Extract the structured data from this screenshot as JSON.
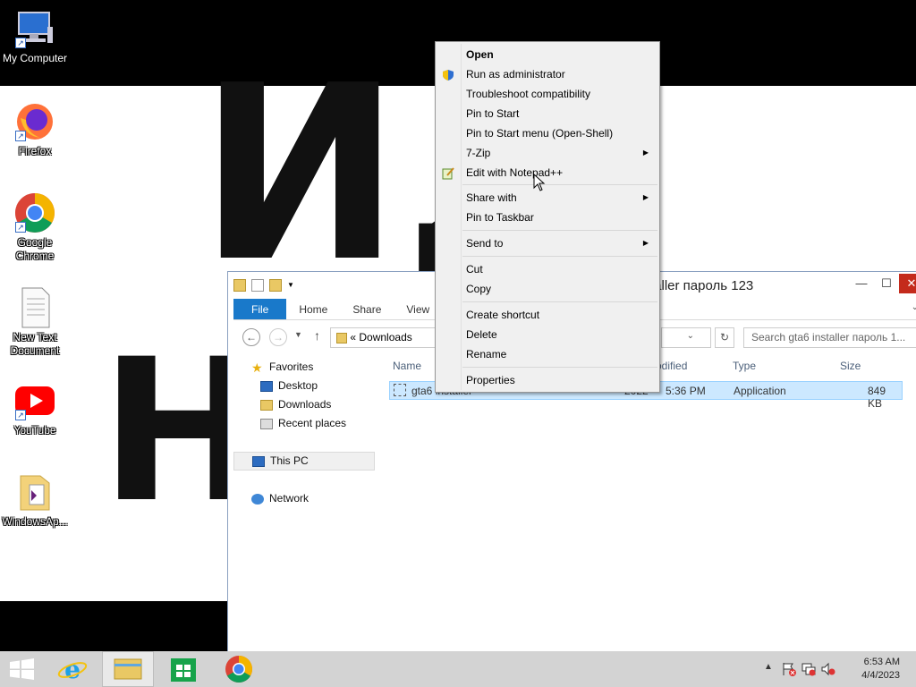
{
  "desktop": {
    "icons": [
      {
        "label": "My Computer"
      },
      {
        "label": "Firefox"
      },
      {
        "label": "Google Chrome"
      },
      {
        "label": "New Text Document"
      },
      {
        "label": "YouTube"
      },
      {
        "label": "WindowsAp..."
      }
    ],
    "wallpaper_text_top": "ИД",
    "wallpaper_text_bottom": "Н"
  },
  "explorer": {
    "title": "tallerпароль 123",
    "title_display": "taller пароль 123",
    "ribbon_tabs": [
      "File",
      "Home",
      "Share",
      "View"
    ],
    "address_prefix": "«",
    "address": "Downloads",
    "search_placeholder": "Search gta6 installer пароль 1...",
    "nav": {
      "favorites": "Favorites",
      "desktop": "Desktop",
      "downloads": "Downloads",
      "recent": "Recent places",
      "thispc": "This PC",
      "network": "Network"
    },
    "columns": {
      "name": "Name",
      "modified": "odified",
      "type": "Type",
      "size": "Size"
    },
    "file": {
      "name": "gta6 installer",
      "date": "5:36 PM",
      "date_prefix": "2022",
      "type": "Application",
      "size": "849 KB"
    }
  },
  "context_menu": {
    "items": [
      {
        "label": "Open"
      },
      {
        "label": "Run as administrator"
      },
      {
        "label": "Troubleshoot compatibility"
      },
      {
        "label": "Pin to Start"
      },
      {
        "label": "Pin to Start menu (Open-Shell)"
      },
      {
        "label": "7-Zip"
      },
      {
        "label": "Edit with Notepad++"
      },
      {
        "label": "Share with"
      },
      {
        "label": "Pin to Taskbar"
      },
      {
        "label": "Send to"
      },
      {
        "label": "Cut"
      },
      {
        "label": "Copy"
      },
      {
        "label": "Create shortcut"
      },
      {
        "label": "Delete"
      },
      {
        "label": "Rename"
      },
      {
        "label": "Properties"
      }
    ]
  },
  "taskbar": {
    "time": "6:53 AM",
    "date": "4/4/2023"
  }
}
